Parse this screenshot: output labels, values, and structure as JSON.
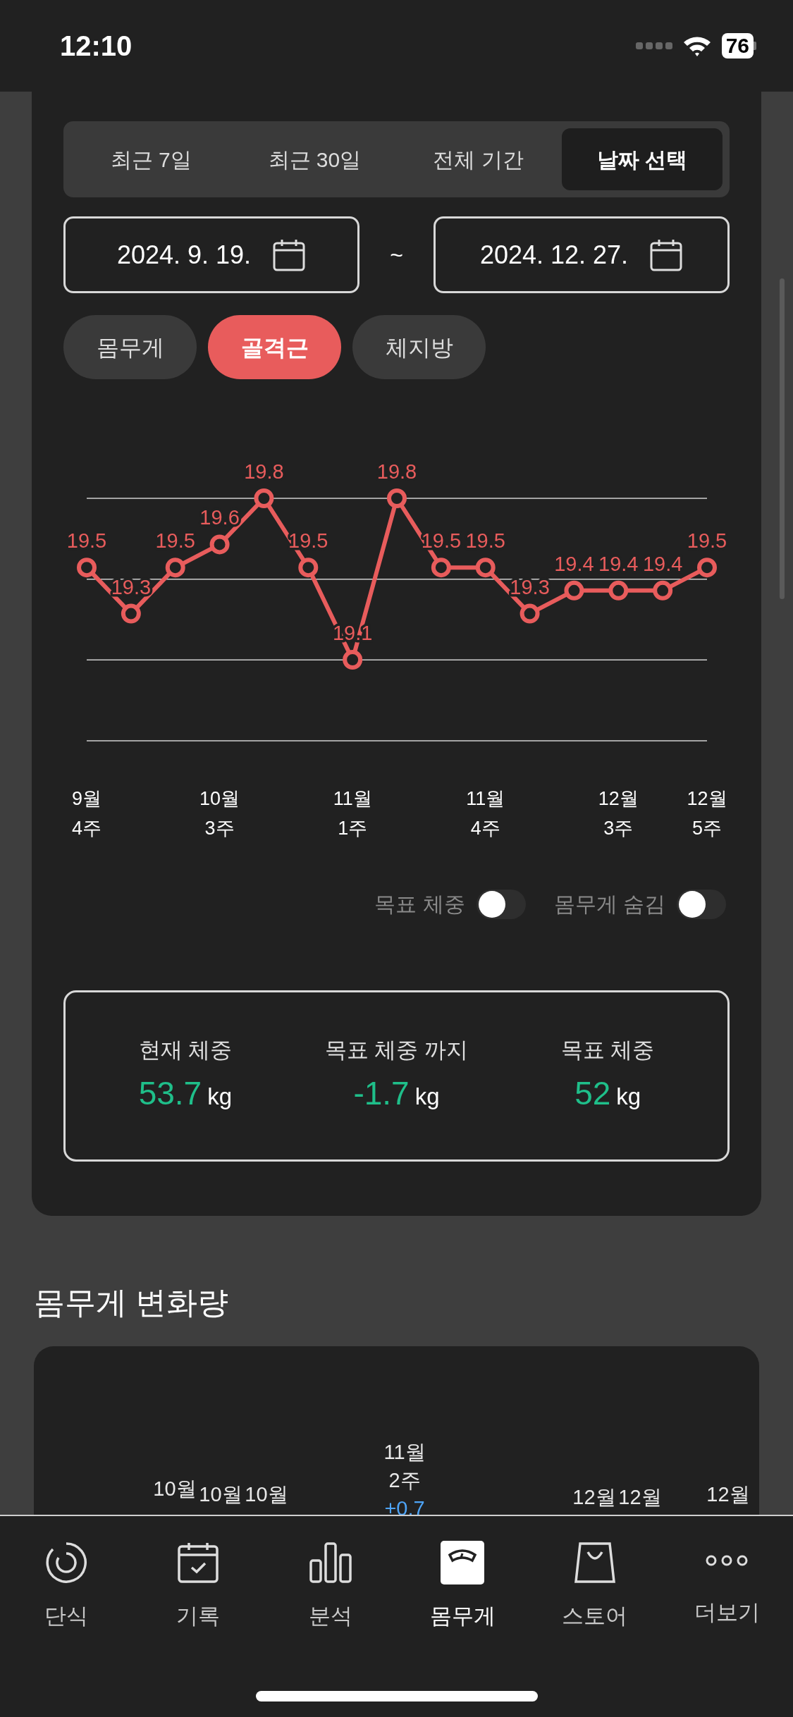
{
  "status_bar": {
    "time": "12:10",
    "battery": "76"
  },
  "period_tabs": [
    {
      "label": "최근 7일",
      "selected": false
    },
    {
      "label": "최근 30일",
      "selected": false
    },
    {
      "label": "전체 기간",
      "selected": false
    },
    {
      "label": "날짜 선택",
      "selected": true
    }
  ],
  "date_range": {
    "start": "2024. 9. 19.",
    "separator": "~",
    "end": "2024. 12. 27."
  },
  "metric_chips": [
    {
      "label": "몸무게",
      "selected": false
    },
    {
      "label": "골격근",
      "selected": true
    },
    {
      "label": "체지방",
      "selected": false
    }
  ],
  "chart_data": {
    "type": "line",
    "data_labels": true,
    "categories": [
      "9월 4주",
      null,
      null,
      "10월 3주",
      null,
      null,
      "11월 1주",
      null,
      null,
      "11월 4주",
      null,
      null,
      "12월 3주",
      null,
      "12월 5주"
    ],
    "series": [
      {
        "color": "#e85c5c",
        "marker": "o",
        "values": [
          19.5,
          19.3,
          19.5,
          19.6,
          19.8,
          19.5,
          19.1,
          19.8,
          19.5,
          19.5,
          19.3,
          19.4,
          19.4,
          19.4,
          19.5
        ]
      }
    ]
  },
  "toggles": [
    {
      "label": "목표 체중",
      "on": false
    },
    {
      "label": "몸무게 숨김",
      "on": false
    }
  ],
  "stats": [
    {
      "label": "현재 체중",
      "value": "53.7",
      "unit": "kg"
    },
    {
      "label": "목표 체중 까지",
      "value": "-1.7",
      "unit": "kg"
    },
    {
      "label": "목표 체중",
      "value": "52",
      "unit": "kg"
    }
  ],
  "change_section": {
    "title": "몸무게 변화량",
    "labels": [
      {
        "text": "10월"
      },
      {
        "text": "10월"
      },
      {
        "text": "10월"
      },
      {
        "text": "11월 2주",
        "change": "+0.7"
      },
      {
        "text": "12월"
      },
      {
        "text": "12월"
      },
      {
        "text": "12월"
      }
    ]
  },
  "tab_bar": [
    {
      "label": "단식",
      "selected": false
    },
    {
      "label": "기록",
      "selected": false
    },
    {
      "label": "분석",
      "selected": false
    },
    {
      "label": "몸무게",
      "selected": true
    },
    {
      "label": "스토어",
      "selected": false
    },
    {
      "label": "더보기",
      "selected": false
    }
  ]
}
